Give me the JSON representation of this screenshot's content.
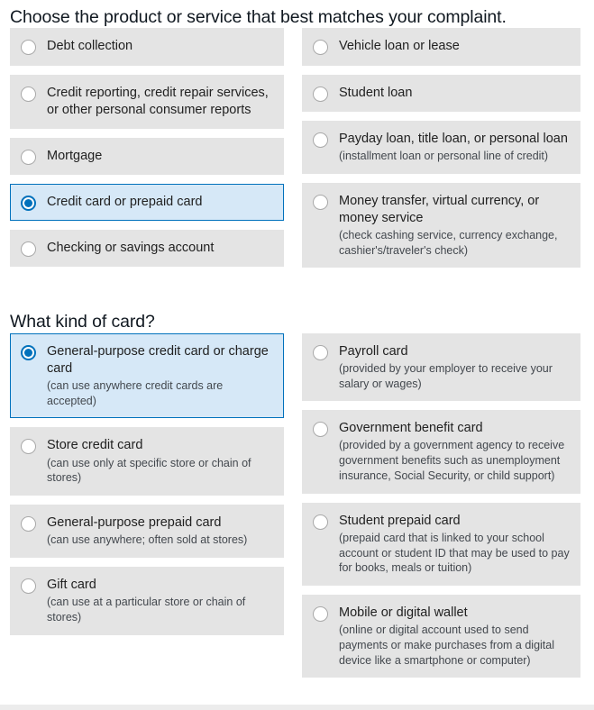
{
  "sections": [
    {
      "id": "product",
      "heading": "Choose the product or service that best matches your complaint.",
      "left_options": [
        {
          "label": "Debt collection",
          "sub": "",
          "selected": false
        },
        {
          "label": "Credit reporting, credit repair services, or other personal consumer reports",
          "sub": "",
          "selected": false
        },
        {
          "label": "Mortgage",
          "sub": "",
          "selected": false
        },
        {
          "label": "Credit card or prepaid card",
          "sub": "",
          "selected": true
        },
        {
          "label": "Checking or savings account",
          "sub": "",
          "selected": false
        }
      ],
      "right_options": [
        {
          "label": "Vehicle loan or lease",
          "sub": "",
          "selected": false
        },
        {
          "label": "Student loan",
          "sub": "",
          "selected": false
        },
        {
          "label": "Payday loan, title loan, or personal loan",
          "sub": "(installment loan or personal line of credit)",
          "selected": false
        },
        {
          "label": "Money transfer, virtual currency, or money service",
          "sub": "(check cashing service, currency exchange, cashier's/traveler's check)",
          "selected": false
        }
      ]
    },
    {
      "id": "card",
      "heading": "What kind of card?",
      "left_options": [
        {
          "label": "General-purpose credit card or charge card",
          "sub": "(can use anywhere credit cards are accepted)",
          "selected": true
        },
        {
          "label": "Store credit card",
          "sub": "(can use only at specific store or chain of stores)",
          "selected": false
        },
        {
          "label": "General-purpose prepaid card",
          "sub": "(can use anywhere; often sold at stores)",
          "selected": false
        },
        {
          "label": "Gift card",
          "sub": "(can use at a particular store or chain of stores)",
          "selected": false
        }
      ],
      "right_options": [
        {
          "label": "Payroll card",
          "sub": "(provided by your employer to receive your salary or wages)",
          "selected": false
        },
        {
          "label": "Government benefit card",
          "sub": "(provided by a government agency to receive government benefits such as unemployment insurance, Social Security, or child support)",
          "selected": false
        },
        {
          "label": "Student prepaid card",
          "sub": "(prepaid card that is linked to your school account or student ID that may be used to pay for books, meals or tuition)",
          "selected": false
        },
        {
          "label": "Mobile or digital wallet",
          "sub": "(online or digital account used to send payments or make purchases from a digital device like a smartphone or computer)",
          "selected": false
        }
      ]
    }
  ],
  "colors": {
    "option_background": "#e4e4e4",
    "option_selected_background": "#d6e8f7",
    "accent": "#0071bc",
    "text": "#212121",
    "page_background": "#ffffff"
  }
}
